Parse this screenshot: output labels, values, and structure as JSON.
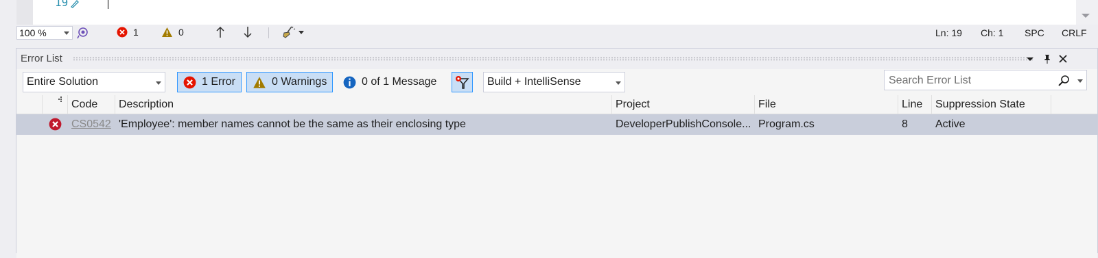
{
  "editor": {
    "line_number": "19"
  },
  "status_bar": {
    "zoom": "100 %",
    "error_count": "1",
    "warning_count": "0",
    "ln": "Ln: 19",
    "ch": "Ch: 1",
    "indent": "SPC",
    "line_ending": "CRLF"
  },
  "error_list": {
    "title": "Error List",
    "scope": "Entire Solution",
    "errors_toggle": "1 Error",
    "warnings_toggle": "0 Warnings",
    "messages_toggle": "0 of 1 Message",
    "build_filter": "Build + IntelliSense",
    "search_placeholder": "Search Error List",
    "columns": {
      "code": "Code",
      "description": "Description",
      "project": "Project",
      "file": "File",
      "line": "Line",
      "suppression": "Suppression State"
    },
    "rows": [
      {
        "code": "CS0542",
        "description": "'Employee': member names cannot be the same as their enclosing type",
        "project": "DeveloperPublishConsole...",
        "file": "Program.cs",
        "line": "8",
        "suppression": "Active"
      }
    ]
  },
  "colors": {
    "error_red": "#e51400",
    "warning_amber": "#a27b00",
    "info_blue": "#1ba1e2",
    "selection_row": "#c9cedb",
    "toggle_on": "#c9def5"
  }
}
